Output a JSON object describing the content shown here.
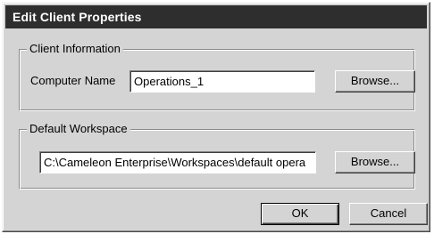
{
  "dialog": {
    "title": "Edit Client Properties"
  },
  "client_information": {
    "legend": "Client Information",
    "computer_name_label": "Computer Name",
    "computer_name_value": "Operations_1",
    "browse_label": "Browse..."
  },
  "default_workspace": {
    "legend": "Default Workspace",
    "path_value": "C:\\Cameleon Enterprise\\Workspaces\\default opera",
    "browse_label": "Browse..."
  },
  "buttons": {
    "ok_label": "OK",
    "cancel_label": "Cancel"
  },
  "colors": {
    "title_bar": "#2e2e2e",
    "dialog_face": "#d4d4d4",
    "field_background": "#ffffff"
  }
}
